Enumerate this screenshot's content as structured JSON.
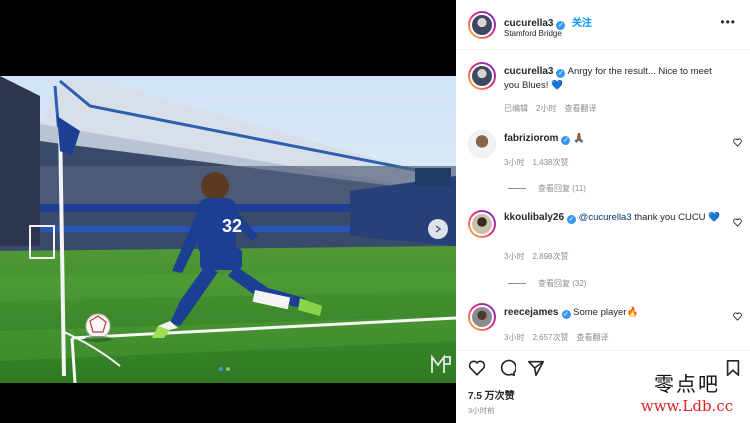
{
  "post": {
    "username": "cucurella3",
    "follow_label": "关注",
    "location": "Stamford Bridge",
    "more_label": "•••",
    "caption": {
      "username": "cucurella3",
      "text": "Anrgy for the result... Nice to meet you Blues! 💙",
      "edited": "已编辑",
      "time": "2小时",
      "translate": "查看翻译"
    },
    "likes": "7.5 万次赞",
    "post_time": "3小时前"
  },
  "photo": {
    "player_number": "32",
    "carousel_total": 2,
    "carousel_active": 1
  },
  "comments": [
    {
      "username": "fabriziorom",
      "text": "🙏🏾",
      "time": "3小时",
      "likes": "1,438次赞",
      "replies": "查看回复 (11)"
    },
    {
      "username": "kkoulibaly26",
      "mention": "@cucurella3",
      "text": " thank you CUCU 💙",
      "time": "3小时",
      "likes": "2,898次赞",
      "replies": "查看回复 (32)"
    },
    {
      "username": "reecejames",
      "text": "Some player🔥",
      "time": "3小时",
      "likes": "2,657次赞",
      "translate": "查看翻译"
    }
  ],
  "watermark": {
    "chinese": "零点吧",
    "url": "www.Ldb.cc"
  },
  "colors": {
    "accent": "#0095f6",
    "verified": "#3897f0",
    "muted": "#8e8e8e",
    "chelsea_blue": "#1c3f94",
    "pitch_green": "#3a8a2c",
    "watermark_red": "#e02222"
  },
  "icons": [
    "verified-icon",
    "more-icon",
    "heart-icon",
    "comment-icon",
    "share-icon",
    "bookmark-icon",
    "chevron-right-icon"
  ]
}
